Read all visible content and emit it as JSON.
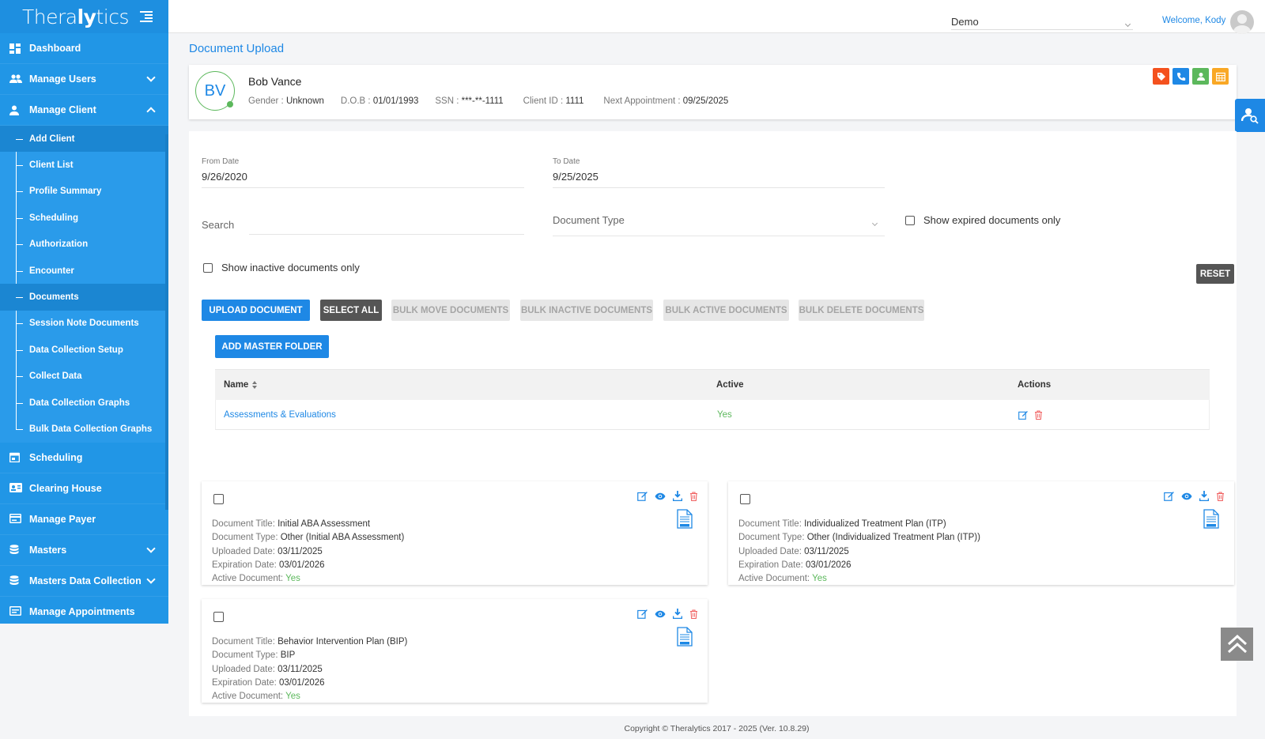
{
  "brand": {
    "logo_pre": "Thera",
    "logo_bold": "ly",
    "logo_post": "tics"
  },
  "sidebar": {
    "items": [
      {
        "label": "Dashboard",
        "icon": "dashboard-icon"
      },
      {
        "label": "Manage Users",
        "icon": "users-icon"
      },
      {
        "label": "Manage Client",
        "icon": "person-icon"
      }
    ],
    "client_sub": [
      "Add Client",
      "Client List",
      "Profile Summary",
      "Scheduling",
      "Authorization",
      "Encounter",
      "Documents",
      "Session Note Documents",
      "Data Collection Setup",
      "Collect Data",
      "Data Collection Graphs",
      "Bulk Data Collection Graphs"
    ],
    "items_after": [
      {
        "label": "Scheduling"
      },
      {
        "label": "Clearing House"
      },
      {
        "label": "Manage Payer"
      },
      {
        "label": "Masters"
      },
      {
        "label": "Masters Data Collection"
      },
      {
        "label": "Manage Appointments"
      }
    ]
  },
  "topbar": {
    "org_select": "Demo",
    "welcome": "Welcome, Kody"
  },
  "page": {
    "title": "Document Upload"
  },
  "client": {
    "initials": "BV",
    "name": "Bob Vance",
    "gender_label": "Gender : ",
    "gender": "Unknown",
    "dob_label": "D.O.B : ",
    "dob": "01/01/1993",
    "ssn_label": "SSN : ",
    "ssn": "***-**-1111",
    "id_label": "Client ID : ",
    "id": "1111",
    "next_label": "Next Appointment : ",
    "next": "09/25/2025",
    "icon_colors": [
      "#f4511e",
      "#1e88e5",
      "#5cb85c",
      "#f9a825"
    ]
  },
  "filters": {
    "from_label": "From Date",
    "from_value": "9/26/2020",
    "to_label": "To Date",
    "to_value": "9/25/2025",
    "search_placeholder": "Search",
    "doc_type_placeholder": "Document Type",
    "expired_label": "Show expired documents only",
    "inactive_label": "Show inactive documents only",
    "reset": "RESET"
  },
  "actions": {
    "upload": "UPLOAD DOCUMENT",
    "select_all": "SELECT ALL",
    "bulk_move": "BULK MOVE DOCUMENTS",
    "bulk_inactive": "BULK INACTIVE DOCUMENTS",
    "bulk_active": "BULK ACTIVE DOCUMENTS",
    "bulk_delete": "BULK DELETE DOCUMENTS",
    "add_folder": "ADD MASTER FOLDER"
  },
  "table": {
    "headers": {
      "name": "Name",
      "active": "Active",
      "actions": "Actions"
    },
    "rows": [
      {
        "name": "Assessments & Evaluations",
        "active": "Yes"
      }
    ]
  },
  "doc_labels": {
    "title": "Document Title: ",
    "type": "Document Type: ",
    "uploaded": "Uploaded Date: ",
    "expiration": "Expiration Date: ",
    "active": "Active Document: "
  },
  "documents": [
    {
      "title": "Initial ABA Assessment",
      "type": "Other (Initial ABA Assessment)",
      "uploaded": "03/11/2025",
      "expiration": "03/01/2026",
      "active": "Yes"
    },
    {
      "title": "Individualized Treatment Plan (ITP)",
      "type": "Other (Individualized Treatment Plan (ITP))",
      "uploaded": "03/11/2025",
      "expiration": "03/01/2026",
      "active": "Yes"
    },
    {
      "title": "Behavior Intervention Plan (BIP)",
      "type": "BIP",
      "uploaded": "03/11/2025",
      "expiration": "03/01/2026",
      "active": "Yes"
    }
  ],
  "footer": "Copyright © Theralytics 2017 - 2025 (Ver. 10.8.29)"
}
